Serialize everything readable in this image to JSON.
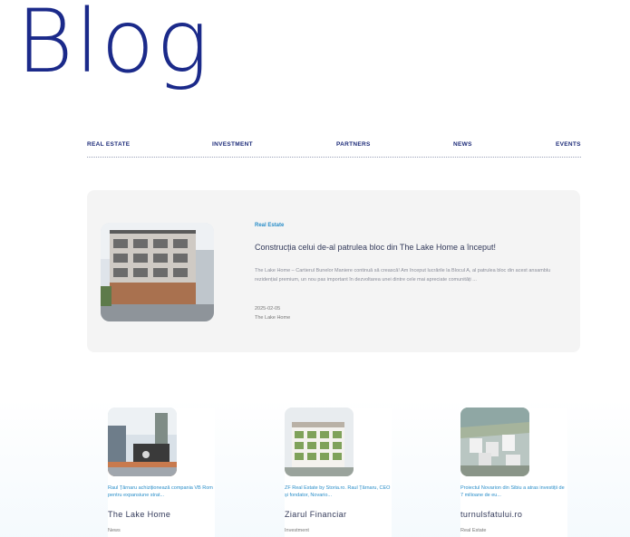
{
  "page": {
    "title": "Blog"
  },
  "nav": {
    "items": [
      {
        "label": "REAL ESTATE"
      },
      {
        "label": "INVESTMENT"
      },
      {
        "label": "PARTNERS"
      },
      {
        "label": "NEWS"
      },
      {
        "label": "EVENTS"
      }
    ]
  },
  "featured": {
    "category": "Real Estate",
    "title": "Construcția celui de-al patrulea bloc din The Lake Home a început!",
    "excerpt": "The Lake Home – Cartierul Bunelor Maniere continuă să crească! Am început lucrările la Blocul A, al patrulea bloc din acest ansamblu rezidențial premium, un nou pas important în dezvoltarea unei dintre cele mai apreciate comunități ...",
    "date": "2025-02-05",
    "source": "The Lake Home"
  },
  "cards": [
    {
      "headline": "Raul Țărnaru achiziționează compania VB Rom pentru expansiune strat...",
      "source": "The Lake Home",
      "category": "News"
    },
    {
      "headline": "ZF Real Estate by Storia.ro. Raul Țărnaru, CEO și fondator, Novario...",
      "source": "Ziarul Financiar",
      "category": "Investment"
    },
    {
      "headline": "Proiectul Novarion din Sibiu a atras investiții de 7 milioane de eu...",
      "source": "turnulsfatului.ro",
      "category": "Real Estate"
    }
  ],
  "colors": {
    "brand": "#1b2a8a",
    "accent": "#2a8ec9",
    "card_bg": "#f4f4f4"
  }
}
